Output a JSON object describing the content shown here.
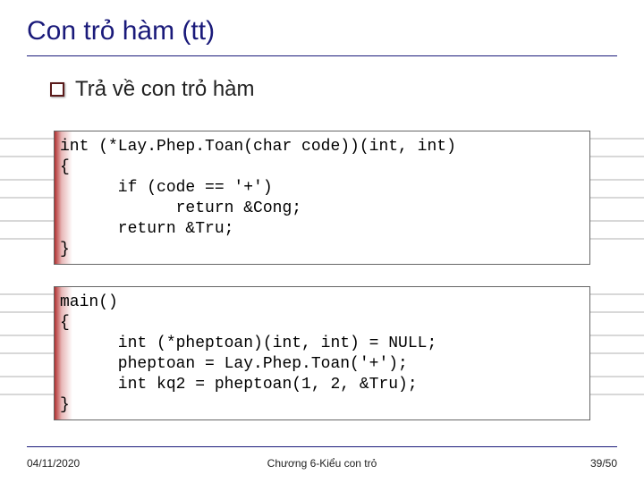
{
  "title": "Con trỏ hàm (tt)",
  "bullet": "Trả về con trỏ hàm",
  "code1": {
    "l0": "int (*Lay.Phep.Toan(char code))(int, int)",
    "l1": "{",
    "l2": "      if (code == '+')",
    "l3": "            return &Cong;",
    "l4": "      return &Tru;",
    "l5": "}"
  },
  "code2": {
    "l0": "main()",
    "l1": "{",
    "l2": "      int (*pheptoan)(int, int) = NULL;",
    "l3": "      pheptoan = Lay.Phep.Toan('+');",
    "l4": "      int kq2 = pheptoan(1, 2, &Tru);",
    "l5": "}"
  },
  "footer": {
    "date": "04/11/2020",
    "chapter": "Chương 6-Kiểu con trỏ",
    "page": "39/50"
  }
}
